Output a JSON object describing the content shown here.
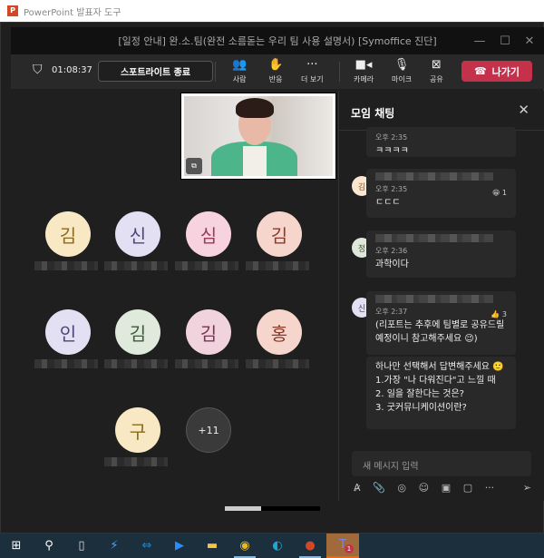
{
  "app_title": "PowerPoint 발표자 도구",
  "meeting_title": "[일정 안내] 완.소.팀(완전 소름돋는 우리 팀 사용 설명서) [Symoffice 진단]",
  "toolbar": {
    "timer": "01:08:37",
    "spotlight_label": "스포트라이트 종료",
    "people": "사람",
    "reactions": "반응",
    "more": "더 보기",
    "camera": "카메라",
    "mic": "마이크",
    "share": "공유",
    "leave": "나가기",
    "leave_color": "#c4314b"
  },
  "participants": [
    {
      "initial": "김",
      "bg": "#f8e9c4",
      "fg": "#8a6a1c"
    },
    {
      "initial": "신",
      "bg": "#e3e0f3",
      "fg": "#4a4678"
    },
    {
      "initial": "심",
      "bg": "#f6d3df",
      "fg": "#9a3a5c"
    },
    {
      "initial": "김",
      "bg": "#f6d6cc",
      "fg": "#8a3a2a"
    },
    {
      "initial": "인",
      "bg": "#e3e0f3",
      "fg": "#4a4678"
    },
    {
      "initial": "김",
      "bg": "#dfeadc",
      "fg": "#3d5a38"
    },
    {
      "initial": "김",
      "bg": "#f1d3de",
      "fg": "#7a3450"
    },
    {
      "initial": "홍",
      "bg": "#f6d6cc",
      "fg": "#8a3a2a"
    },
    {
      "initial": "구",
      "bg": "#f8e9c4",
      "fg": "#8a6a1c"
    }
  ],
  "overflow_count": "+11",
  "chat": {
    "title": "모임 채팅",
    "messages": [
      {
        "time": "오후 2:35",
        "text": "ㅋㅋㅋㅋ"
      },
      {
        "initial": "김",
        "time": "오후 2:35",
        "text": "ㄷㄷㄷ",
        "reaction": "😁 1"
      },
      {
        "initial": "정",
        "time": "오후 2:36",
        "text": "과학이다"
      },
      {
        "initial": "신",
        "time": "오후 2:37",
        "text": "(리포트는 추후에 팀별로 공유드릴 예정이니 참고해주세요 😉)",
        "reaction": "👍 3"
      },
      {
        "text_lines": [
          "하나만 선택해서 답변해주세요 🙂",
          "1.가장 \"나 다워진다\"고 느낄 때",
          "2. 일을 잘한다는 것은?",
          "3. 굿커뮤니케이션이란?"
        ]
      }
    ],
    "input_placeholder": "새 메시지 입력"
  },
  "taskbar": [
    "windows-start",
    "search",
    "task-view",
    "bolt-app",
    "teamviewer",
    "zoom",
    "file-explorer",
    "chrome",
    "edge",
    "powerpoint",
    "teams"
  ],
  "teams_badge": "1"
}
